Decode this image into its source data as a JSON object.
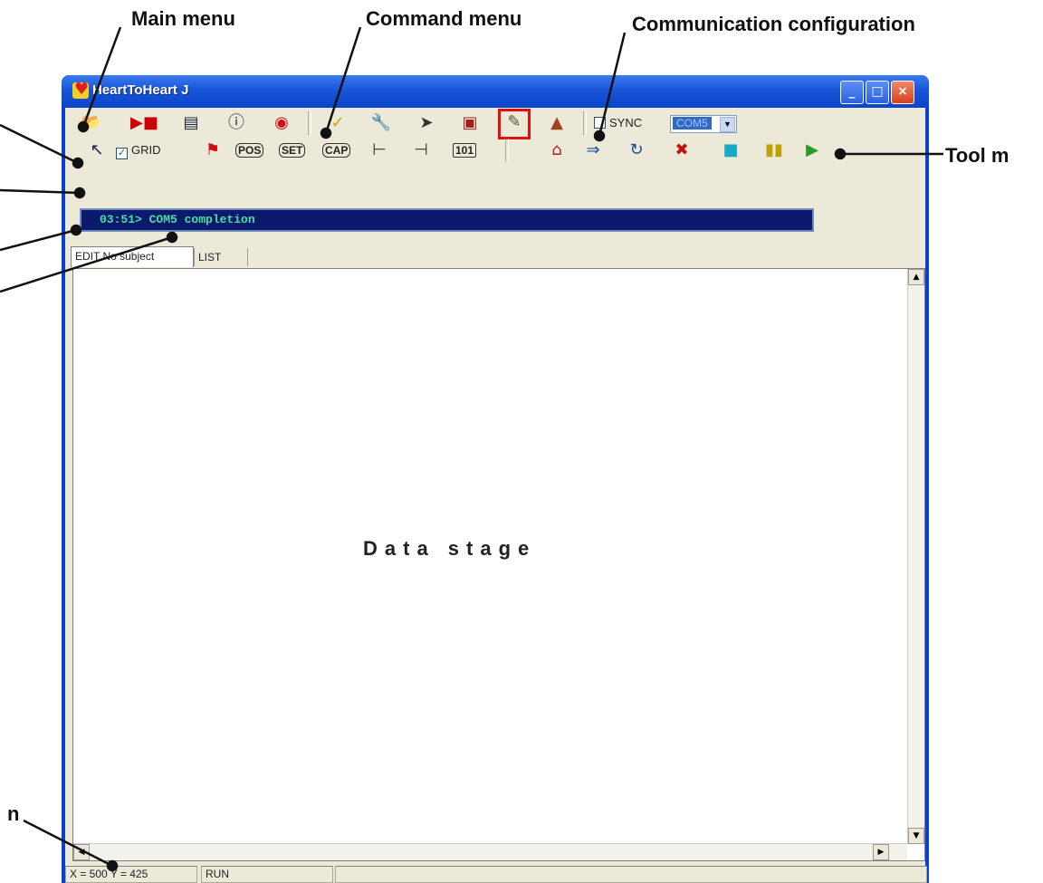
{
  "callouts": {
    "main_menu": "Main menu",
    "command_menu": "Command menu",
    "communication_configuration": "Communication configuration",
    "tool_menu": "Tool m",
    "left_n": "n"
  },
  "window": {
    "title": "HeartToHeart J",
    "min_glyph": "_",
    "max_glyph": "□",
    "close_glyph": "×"
  },
  "toolbar": {
    "sync_label": "SYNC",
    "com_port": "COM5",
    "grid_label": "GRID",
    "grid_checked": true,
    "pos_label": "POS",
    "set_label": "SET",
    "cap_label": "CAP",
    "bin_label": "101"
  },
  "status": {
    "message": "03:51> COM5 completion"
  },
  "tabs": {
    "edit": "EDIT No subject",
    "list": "LIST"
  },
  "stage": {
    "label": "Data stage"
  },
  "statusbar": {
    "coords": "X = 500  Y = 425",
    "mode": "RUN"
  },
  "icons": {
    "open": "open-folder-icon",
    "save": "save-icon",
    "window": "window-icon",
    "info": "info-icon",
    "stop": "stop-icon",
    "highlight_color": "#e01010"
  }
}
